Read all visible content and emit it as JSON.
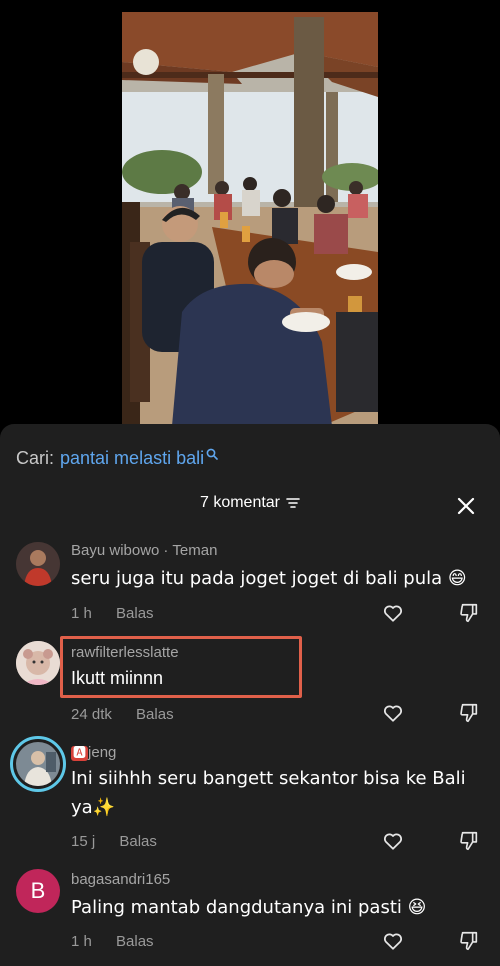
{
  "search": {
    "prefix": "Cari:",
    "query": "pantai melasti bali"
  },
  "header": {
    "comment_count": "7 komentar"
  },
  "comments": [
    {
      "username": "Bayu wibowo",
      "relation": "Teman",
      "text": "seru juga itu pada joget joget di bali pula 😄",
      "time": "1 h",
      "reply_label": "Balas"
    },
    {
      "username": "rawfilterlesslatte",
      "text": "Ikutt miinnn",
      "time": "24 dtk",
      "reply_label": "Balas"
    },
    {
      "username_badge": "🅰",
      "username": "jeng",
      "text": "Ini siihhh seru bangett sekantor bisa ke Bali ya✨",
      "time": "15 j",
      "reply_label": "Balas"
    },
    {
      "avatar_letter": "B",
      "username": "bagasandri165",
      "text": "Paling mantab dangdutanya ini pasti 😆",
      "time": "1 h",
      "reply_label": "Balas"
    }
  ],
  "colors": {
    "sheet_bg": "#1f1f1f",
    "link_blue": "#5fa6ee",
    "highlight": "#e0604a",
    "avatar_b": "#c0265a"
  }
}
